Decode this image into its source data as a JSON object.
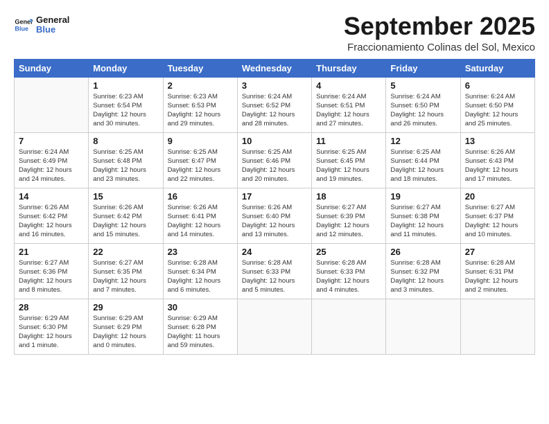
{
  "logo": {
    "line1": "General",
    "line2": "Blue"
  },
  "title": "September 2025",
  "subtitle": "Fraccionamiento Colinas del Sol, Mexico",
  "days_of_week": [
    "Sunday",
    "Monday",
    "Tuesday",
    "Wednesday",
    "Thursday",
    "Friday",
    "Saturday"
  ],
  "weeks": [
    [
      {
        "day": "",
        "info": ""
      },
      {
        "day": "1",
        "info": "Sunrise: 6:23 AM\nSunset: 6:54 PM\nDaylight: 12 hours\nand 30 minutes."
      },
      {
        "day": "2",
        "info": "Sunrise: 6:23 AM\nSunset: 6:53 PM\nDaylight: 12 hours\nand 29 minutes."
      },
      {
        "day": "3",
        "info": "Sunrise: 6:24 AM\nSunset: 6:52 PM\nDaylight: 12 hours\nand 28 minutes."
      },
      {
        "day": "4",
        "info": "Sunrise: 6:24 AM\nSunset: 6:51 PM\nDaylight: 12 hours\nand 27 minutes."
      },
      {
        "day": "5",
        "info": "Sunrise: 6:24 AM\nSunset: 6:50 PM\nDaylight: 12 hours\nand 26 minutes."
      },
      {
        "day": "6",
        "info": "Sunrise: 6:24 AM\nSunset: 6:50 PM\nDaylight: 12 hours\nand 25 minutes."
      }
    ],
    [
      {
        "day": "7",
        "info": "Sunrise: 6:24 AM\nSunset: 6:49 PM\nDaylight: 12 hours\nand 24 minutes."
      },
      {
        "day": "8",
        "info": "Sunrise: 6:25 AM\nSunset: 6:48 PM\nDaylight: 12 hours\nand 23 minutes."
      },
      {
        "day": "9",
        "info": "Sunrise: 6:25 AM\nSunset: 6:47 PM\nDaylight: 12 hours\nand 22 minutes."
      },
      {
        "day": "10",
        "info": "Sunrise: 6:25 AM\nSunset: 6:46 PM\nDaylight: 12 hours\nand 20 minutes."
      },
      {
        "day": "11",
        "info": "Sunrise: 6:25 AM\nSunset: 6:45 PM\nDaylight: 12 hours\nand 19 minutes."
      },
      {
        "day": "12",
        "info": "Sunrise: 6:25 AM\nSunset: 6:44 PM\nDaylight: 12 hours\nand 18 minutes."
      },
      {
        "day": "13",
        "info": "Sunrise: 6:26 AM\nSunset: 6:43 PM\nDaylight: 12 hours\nand 17 minutes."
      }
    ],
    [
      {
        "day": "14",
        "info": "Sunrise: 6:26 AM\nSunset: 6:42 PM\nDaylight: 12 hours\nand 16 minutes."
      },
      {
        "day": "15",
        "info": "Sunrise: 6:26 AM\nSunset: 6:42 PM\nDaylight: 12 hours\nand 15 minutes."
      },
      {
        "day": "16",
        "info": "Sunrise: 6:26 AM\nSunset: 6:41 PM\nDaylight: 12 hours\nand 14 minutes."
      },
      {
        "day": "17",
        "info": "Sunrise: 6:26 AM\nSunset: 6:40 PM\nDaylight: 12 hours\nand 13 minutes."
      },
      {
        "day": "18",
        "info": "Sunrise: 6:27 AM\nSunset: 6:39 PM\nDaylight: 12 hours\nand 12 minutes."
      },
      {
        "day": "19",
        "info": "Sunrise: 6:27 AM\nSunset: 6:38 PM\nDaylight: 12 hours\nand 11 minutes."
      },
      {
        "day": "20",
        "info": "Sunrise: 6:27 AM\nSunset: 6:37 PM\nDaylight: 12 hours\nand 10 minutes."
      }
    ],
    [
      {
        "day": "21",
        "info": "Sunrise: 6:27 AM\nSunset: 6:36 PM\nDaylight: 12 hours\nand 8 minutes."
      },
      {
        "day": "22",
        "info": "Sunrise: 6:27 AM\nSunset: 6:35 PM\nDaylight: 12 hours\nand 7 minutes."
      },
      {
        "day": "23",
        "info": "Sunrise: 6:28 AM\nSunset: 6:34 PM\nDaylight: 12 hours\nand 6 minutes."
      },
      {
        "day": "24",
        "info": "Sunrise: 6:28 AM\nSunset: 6:33 PM\nDaylight: 12 hours\nand 5 minutes."
      },
      {
        "day": "25",
        "info": "Sunrise: 6:28 AM\nSunset: 6:33 PM\nDaylight: 12 hours\nand 4 minutes."
      },
      {
        "day": "26",
        "info": "Sunrise: 6:28 AM\nSunset: 6:32 PM\nDaylight: 12 hours\nand 3 minutes."
      },
      {
        "day": "27",
        "info": "Sunrise: 6:28 AM\nSunset: 6:31 PM\nDaylight: 12 hours\nand 2 minutes."
      }
    ],
    [
      {
        "day": "28",
        "info": "Sunrise: 6:29 AM\nSunset: 6:30 PM\nDaylight: 12 hours\nand 1 minute."
      },
      {
        "day": "29",
        "info": "Sunrise: 6:29 AM\nSunset: 6:29 PM\nDaylight: 12 hours\nand 0 minutes."
      },
      {
        "day": "30",
        "info": "Sunrise: 6:29 AM\nSunset: 6:28 PM\nDaylight: 11 hours\nand 59 minutes."
      },
      {
        "day": "",
        "info": ""
      },
      {
        "day": "",
        "info": ""
      },
      {
        "day": "",
        "info": ""
      },
      {
        "day": "",
        "info": ""
      }
    ]
  ]
}
